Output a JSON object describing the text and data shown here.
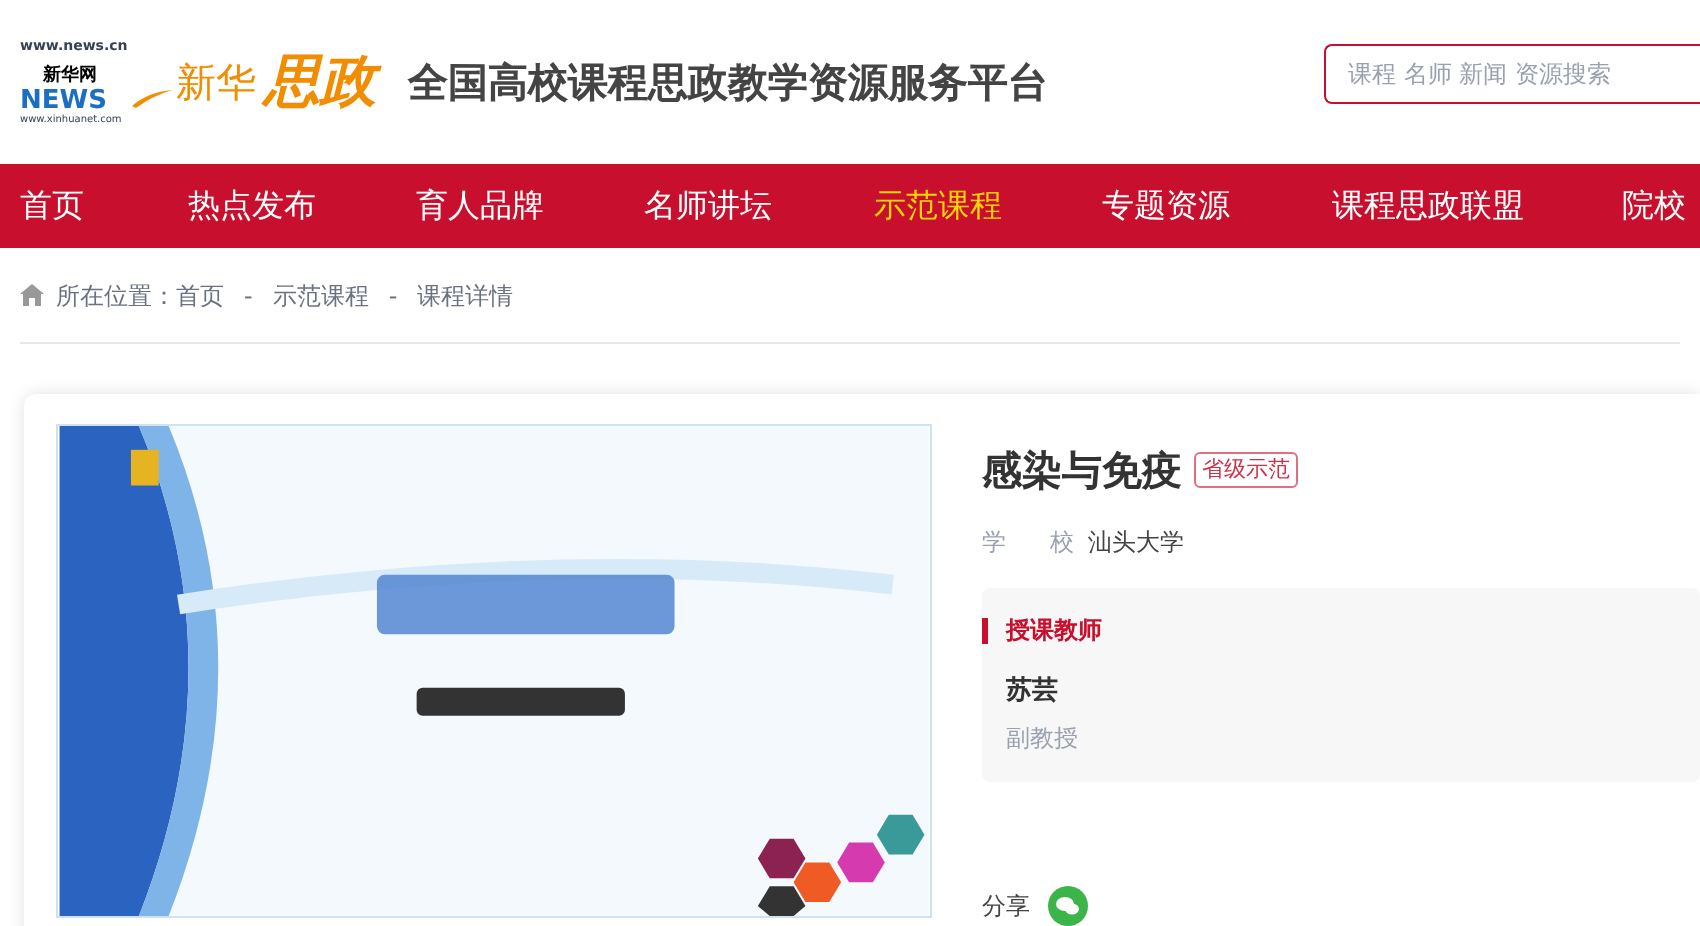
{
  "logo": {
    "site_url": "www.news.cn",
    "brand": "新华网",
    "news": "NEWS",
    "site_url_2": "www.xinhuanet.com",
    "sub_brand_1": "新华",
    "sub_brand_2": "思政"
  },
  "site_title": "全国高校课程思政教学资源服务平台",
  "search": {
    "placeholder": "课程 名师 新闻 资源搜索"
  },
  "nav": [
    {
      "label": "首页",
      "selected": false
    },
    {
      "label": "热点发布",
      "selected": false
    },
    {
      "label": "育人品牌",
      "selected": false
    },
    {
      "label": "名师讲坛",
      "selected": false
    },
    {
      "label": "示范课程",
      "selected": true
    },
    {
      "label": "专题资源",
      "selected": false
    },
    {
      "label": "课程思政联盟",
      "selected": false
    },
    {
      "label": "院校",
      "selected": false
    }
  ],
  "breadcrumb": {
    "prefix": "所在位置：",
    "items": [
      "首页",
      "示范课程",
      "课程详情"
    ],
    "separator": "-"
  },
  "course": {
    "title": "感染与免疫",
    "badge": "省级示范",
    "school_label": [
      "学",
      "校"
    ],
    "school": "汕头大学",
    "teacher_section": {
      "heading": "授课教师",
      "name": "苏芸",
      "rank": "副教授"
    },
    "share_label": "分享"
  }
}
